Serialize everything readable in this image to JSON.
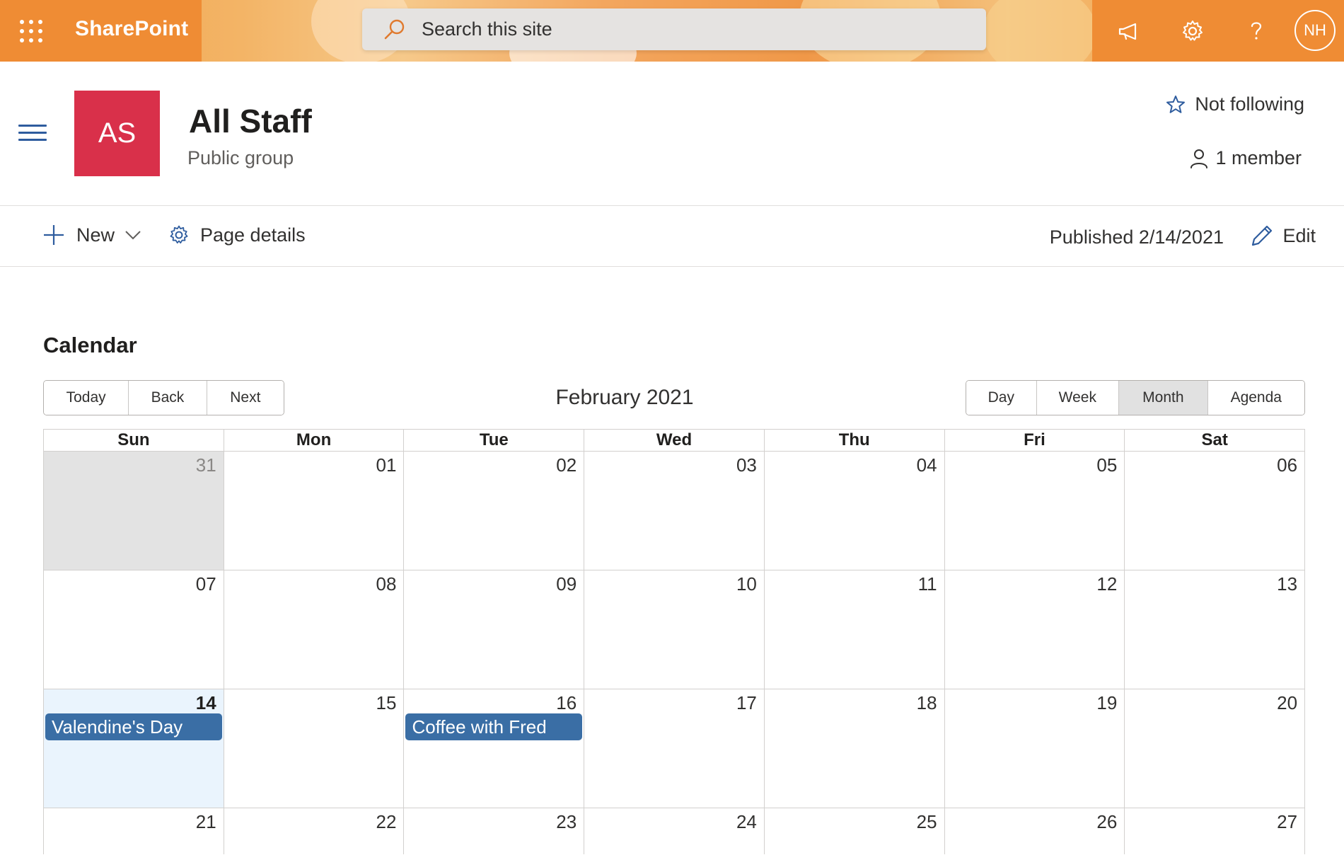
{
  "suitebar": {
    "brand": "SharePoint",
    "search_placeholder": "Search this site",
    "avatar_initials": "NH"
  },
  "site": {
    "logo_initials": "AS",
    "title": "All Staff",
    "subtitle": "Public group",
    "follow_label": "Not following",
    "members_label": "1 member"
  },
  "commandbar": {
    "new_label": "New",
    "page_details_label": "Page details",
    "published": "Published 2/14/2021",
    "edit_label": "Edit"
  },
  "calendar": {
    "title": "Calendar",
    "nav": [
      "Today",
      "Back",
      "Next"
    ],
    "month_label": "February 2021",
    "views": [
      "Day",
      "Week",
      "Month",
      "Agenda"
    ],
    "active_view": "Month",
    "weekdays": [
      "Sun",
      "Mon",
      "Tue",
      "Wed",
      "Thu",
      "Fri",
      "Sat"
    ],
    "weeks": [
      [
        {
          "day": "31",
          "off": true
        },
        {
          "day": "01"
        },
        {
          "day": "02"
        },
        {
          "day": "03"
        },
        {
          "day": "04"
        },
        {
          "day": "05"
        },
        {
          "day": "06"
        }
      ],
      [
        {
          "day": "07"
        },
        {
          "day": "08"
        },
        {
          "day": "09"
        },
        {
          "day": "10"
        },
        {
          "day": "11"
        },
        {
          "day": "12"
        },
        {
          "day": "13"
        }
      ],
      [
        {
          "day": "14",
          "today": true,
          "event": "Valendine's Day"
        },
        {
          "day": "15"
        },
        {
          "day": "16",
          "event": "Coffee with Fred"
        },
        {
          "day": "17"
        },
        {
          "day": "18"
        },
        {
          "day": "19"
        },
        {
          "day": "20"
        }
      ],
      [
        {
          "day": "21"
        },
        {
          "day": "22"
        },
        {
          "day": "23"
        },
        {
          "day": "24"
        },
        {
          "day": "25"
        },
        {
          "day": "26"
        },
        {
          "day": "27"
        }
      ]
    ]
  },
  "colors": {
    "suitebar_accent": "#ef8c34",
    "site_logo": "#d9304a",
    "event": "#3a6ea5",
    "today_bg": "#eaf4fd",
    "icon_blue": "#2e5c9e"
  },
  "icons": {
    "waffle": "app-launcher-icon",
    "search": "search-icon",
    "megaphone": "megaphone-icon",
    "settings": "gear-icon",
    "help": "help-icon",
    "menu": "hamburger-icon",
    "follow": "star-icon",
    "members": "person-icon",
    "new": "plus-icon",
    "chevron": "chevron-down-icon",
    "details": "gear-icon",
    "edit": "pencil-icon"
  }
}
